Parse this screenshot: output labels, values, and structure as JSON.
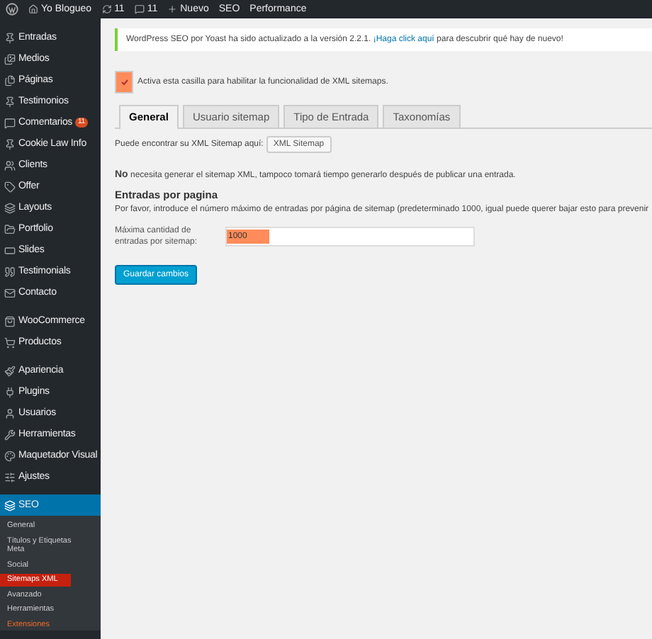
{
  "admin_bar": {
    "items": [
      {
        "kind": "logo"
      },
      {
        "kind": "home",
        "label": "Yo Blogueo"
      },
      {
        "kind": "updates",
        "label": "11"
      },
      {
        "kind": "comments",
        "label": "11"
      },
      {
        "kind": "new",
        "label": "Nuevo"
      },
      {
        "kind": "text",
        "label": "SEO"
      },
      {
        "kind": "text",
        "label": "Performance"
      }
    ]
  },
  "sidebar": {
    "groups": [
      {
        "items": [
          {
            "label": "Entradas",
            "selected": false
          },
          {
            "label": "Medios",
            "selected": false
          },
          {
            "label": "Páginas",
            "selected": false
          },
          {
            "label": "Testimonios",
            "selected": false
          },
          {
            "label": "Comentarios",
            "badge": "11",
            "selected": false
          },
          {
            "label": "Cookie Law Info",
            "selected": false
          },
          {
            "label": "Clients",
            "selected": false
          },
          {
            "label": "Offer",
            "selected": false
          },
          {
            "label": "Layouts",
            "selected": false
          },
          {
            "label": "Portfolio",
            "selected": false
          },
          {
            "label": "Slides",
            "selected": false
          },
          {
            "label": "Testimonials",
            "selected": false
          },
          {
            "label": "Contacto",
            "selected": false
          }
        ]
      },
      {
        "items": [
          {
            "label": "WooCommerce",
            "selected": false
          },
          {
            "label": "Productos",
            "selected": false
          }
        ]
      },
      {
        "items": [
          {
            "label": "Apariencia",
            "selected": false
          },
          {
            "label": "Plugins",
            "selected": false
          },
          {
            "label": "Usuarios",
            "selected": false
          },
          {
            "label": "Herramientas",
            "selected": false
          },
          {
            "label": "Maquetador Visual",
            "selected": false
          },
          {
            "label": "Ajustes",
            "selected": false
          }
        ]
      },
      {
        "items": [
          {
            "label": "SEO",
            "selected": true,
            "submenu": [
              {
                "label": "General",
                "selected": false,
                "kind": "plain"
              },
              {
                "label": "Títulos y Etiquetas Meta",
                "selected": false,
                "kind": "plain"
              },
              {
                "label": "Social",
                "selected": false,
                "kind": "plain"
              },
              {
                "label": "Sitemaps XML",
                "selected": true,
                "kind": "plain"
              },
              {
                "label": "Avanzado",
                "selected": false,
                "kind": "plain"
              },
              {
                "label": "Herramientas",
                "selected": false,
                "kind": "plain"
              },
              {
                "label": "Extensiones",
                "selected": false,
                "kind": "accent"
              }
            ]
          }
        ]
      }
    ]
  },
  "notice": {
    "before": "WordPress SEO por Yoast ha sido actualizado a la versión 2.2.1. ",
    "link": "¡Haga click aquí",
    "after": " para descubrir qué hay de nuevo!"
  },
  "enable_checkbox": {
    "label": "Activa esta casilla para habilitar la funcionalidad de XML sitemaps.",
    "checked": true
  },
  "tabs": [
    {
      "label": "General",
      "selected": true
    },
    {
      "label": "Usuario sitemap",
      "selected": false
    },
    {
      "label": "Tipo de Entrada",
      "selected": false
    },
    {
      "label": "Taxonomías",
      "selected": false
    }
  ],
  "sitemap_link": {
    "label": "Puede encontrar su XML Sitemap aquí:",
    "button": "XML Sitemap"
  },
  "info": "**No** necesita generar el sitemap XML, tampoco tomará tiempo generarlo después de publicar una entrada.",
  "section": {
    "title": "Entradas por pagina",
    "description": "Por favor, introduce el número máximo de entradas por página de sitemap (predeterminado 1000, igual puede querer bajar esto para prevenir"
  },
  "max_entries": {
    "label": "Máxima cantidad de entradas por sitemap:",
    "value": "1000"
  },
  "save_button": "Guardar cambios"
}
